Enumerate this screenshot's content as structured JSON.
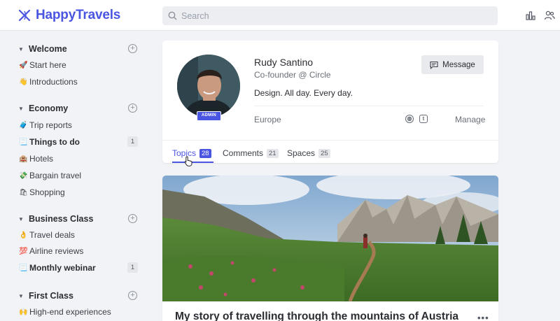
{
  "brand": {
    "name": "HappyTravels",
    "accent": "#4a56e2"
  },
  "search": {
    "placeholder": "Search"
  },
  "header_icons": [
    "leaderboard-icon",
    "members-icon"
  ],
  "sidebar": {
    "sections": [
      {
        "title": "Welcome",
        "items": [
          {
            "emoji": "🚀",
            "label": "Start here"
          },
          {
            "emoji": "👋",
            "label": "Introductions"
          }
        ]
      },
      {
        "title": "Economy",
        "items": [
          {
            "emoji": "🧳",
            "label": "Trip reports"
          },
          {
            "emoji": "📃",
            "label": "Things to do",
            "badge": "1",
            "unread": true
          },
          {
            "emoji": "🏨",
            "label": "Hotels"
          },
          {
            "emoji": "💸",
            "label": "Bargain travel"
          },
          {
            "emoji": "🛍",
            "label": "Shopping"
          }
        ]
      },
      {
        "title": "Business Class",
        "items": [
          {
            "emoji": "👌",
            "label": "Travel deals"
          },
          {
            "emoji": "💯",
            "label": "Airline reviews"
          },
          {
            "emoji": "📃",
            "label": "Monthly webinar",
            "badge": "1",
            "unread": true
          }
        ]
      },
      {
        "title": "First Class",
        "items": [
          {
            "emoji": "🙌",
            "label": "High-end experiences"
          }
        ]
      }
    ]
  },
  "profile": {
    "name": "Rudy Santino",
    "role": "Co-founder @ Circle",
    "bio": "Design. All day. Every day.",
    "badge": "ADMIN",
    "location": "Europe",
    "message_label": "Message",
    "manage_label": "Manage",
    "social_icons": [
      "dribbble-icon",
      "twitter-icon"
    ],
    "social_glyphs": [
      "◍",
      "t"
    ],
    "tabs": [
      {
        "label": "Topics",
        "count": "28",
        "active": true
      },
      {
        "label": "Comments",
        "count": "21",
        "active": false
      },
      {
        "label": "Spaces",
        "count": "25",
        "active": false
      }
    ]
  },
  "post": {
    "title": "My story of travelling through the mountains of Austria",
    "more_label": "•••"
  }
}
